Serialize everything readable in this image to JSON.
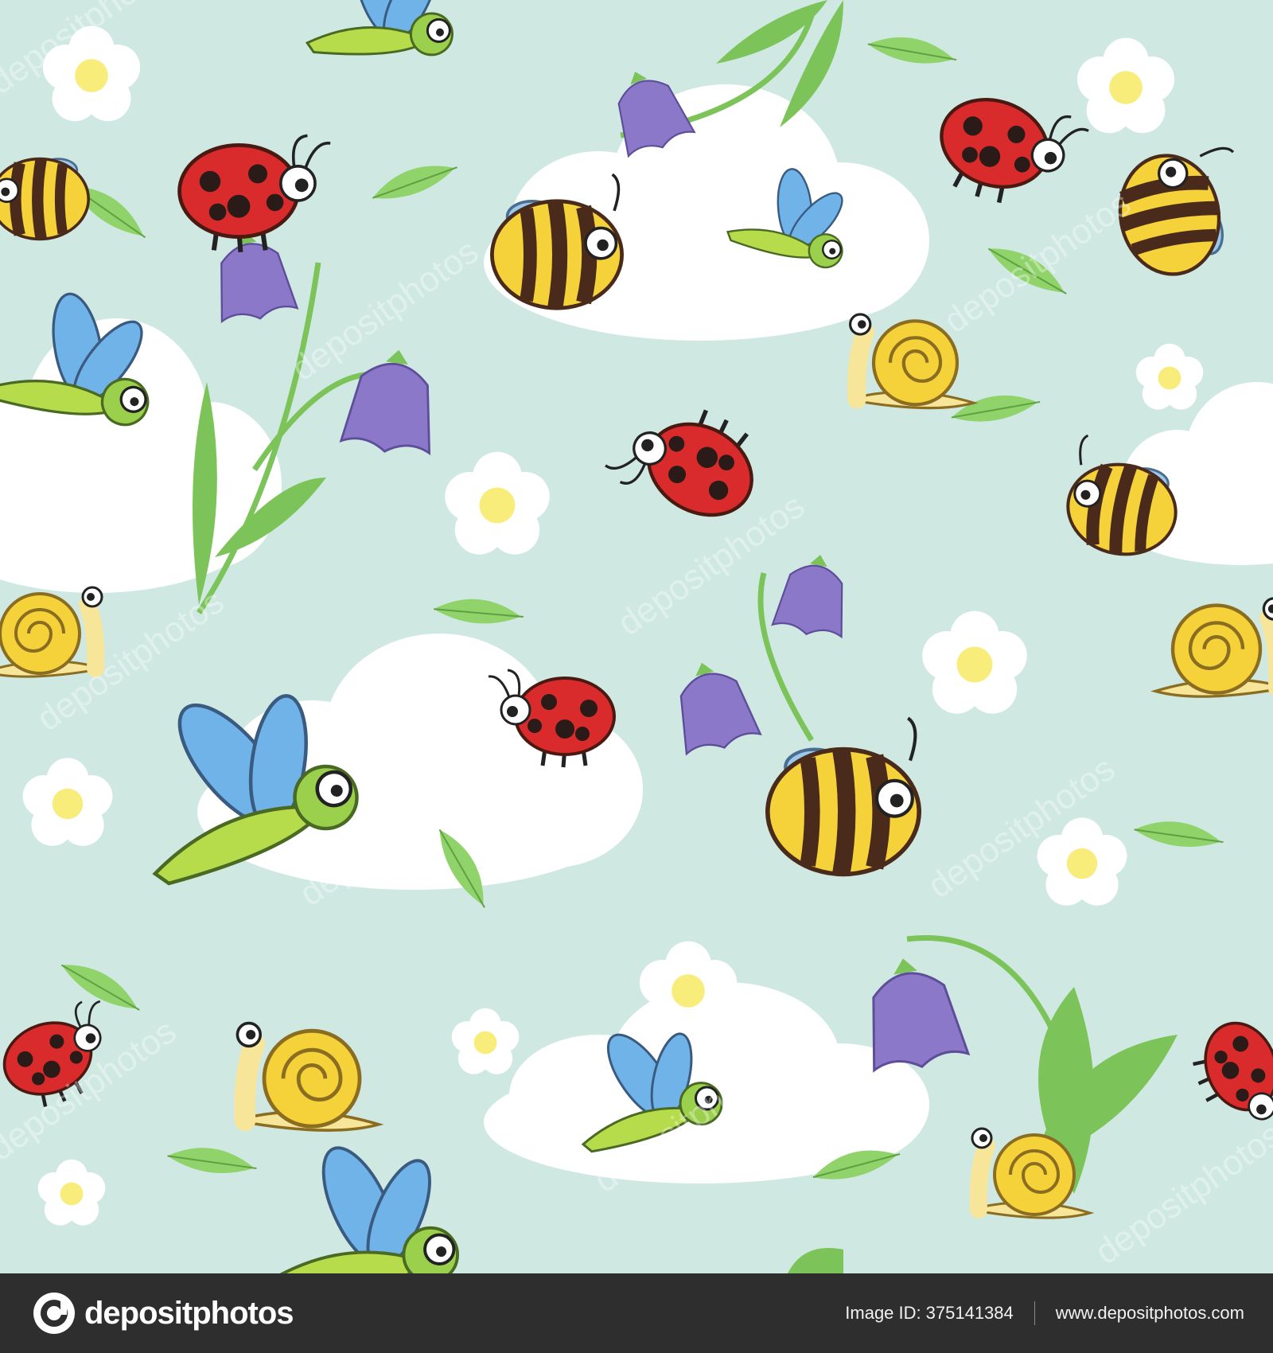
{
  "footer": {
    "brand": "depositphotos",
    "image_id_label": "Image ID:",
    "image_id": "375141384",
    "site": "www.depositphotos.com"
  },
  "watermark": "depositphotos",
  "colors": {
    "background": "#cfe9e2",
    "cloud": "#ffffff",
    "footer": "#2e2e2e",
    "ladybug": "#d92b2b",
    "bee_yellow": "#f5d23a",
    "bee_stripe": "#4a2a1a",
    "wing": "#6fb3e8",
    "bellflower": "#8c78c8",
    "leaf": "#7cc45a"
  },
  "pattern": {
    "subjects": [
      "ladybug",
      "bee",
      "dragonfly",
      "snail",
      "bellflower",
      "daisy",
      "leaf",
      "cloud"
    ]
  }
}
